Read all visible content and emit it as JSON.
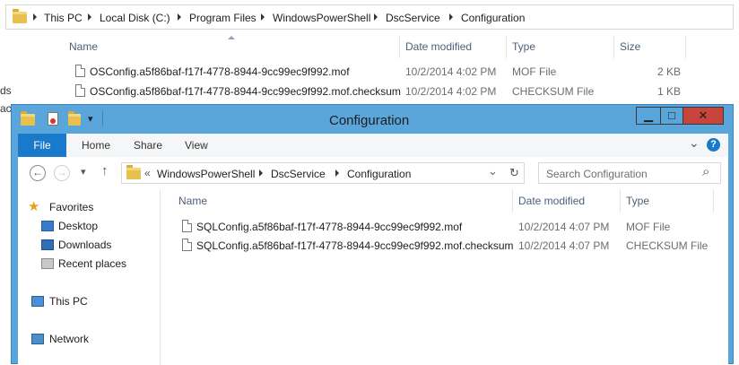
{
  "background_window": {
    "breadcrumb": [
      "This PC",
      "Local Disk (C:)",
      "Program Files",
      "WindowsPowerShell",
      "DscService",
      "Configuration"
    ],
    "columns": [
      "Name",
      "Date modified",
      "Type",
      "Size"
    ],
    "files": [
      {
        "name": "OSConfig.a5f86baf-f17f-4778-8944-9cc99ec9f992.mof",
        "date": "10/2/2014 4:02 PM",
        "type": "MOF File",
        "size": "2 KB"
      },
      {
        "name": "OSConfig.a5f86baf-f17f-4778-8944-9cc99ec9f992.mof.checksum",
        "date": "10/2/2014 4:02 PM",
        "type": "CHECKSUM File",
        "size": "1 KB"
      }
    ],
    "left_fragments": [
      "ds",
      "ac"
    ]
  },
  "window": {
    "title": "Configuration",
    "controls": {
      "minimize": "▁",
      "maximize": "□",
      "close": "✕"
    },
    "ribbon_tabs": [
      "File",
      "Home",
      "Share",
      "View"
    ],
    "ribbon_expand": "⌄",
    "help": "?",
    "nav": {
      "back": "←",
      "forward": "→",
      "dropdown": "▾",
      "up": "↑"
    },
    "address": {
      "overflow": "«",
      "crumbs": [
        "WindowsPowerShell",
        "DscService",
        "Configuration"
      ]
    },
    "address_dropdown": "⌄",
    "refresh": "↻",
    "search": {
      "placeholder": "Search Configuration",
      "icon": "⌕"
    },
    "nav_pane": {
      "favorites": "Favorites",
      "items": [
        "Desktop",
        "Downloads",
        "Recent places"
      ],
      "this_pc": "This PC",
      "network": "Network"
    },
    "columns": [
      "Name",
      "Date modified",
      "Type"
    ],
    "files": [
      {
        "name": "SQLConfig.a5f86baf-f17f-4778-8944-9cc99ec9f992.mof",
        "date": "10/2/2014 4:07 PM",
        "type": "MOF File"
      },
      {
        "name": "SQLConfig.a5f86baf-f17f-4778-8944-9cc99ec9f992.mof.checksum",
        "date": "10/2/2014 4:07 PM",
        "type": "CHECKSUM File"
      }
    ]
  }
}
